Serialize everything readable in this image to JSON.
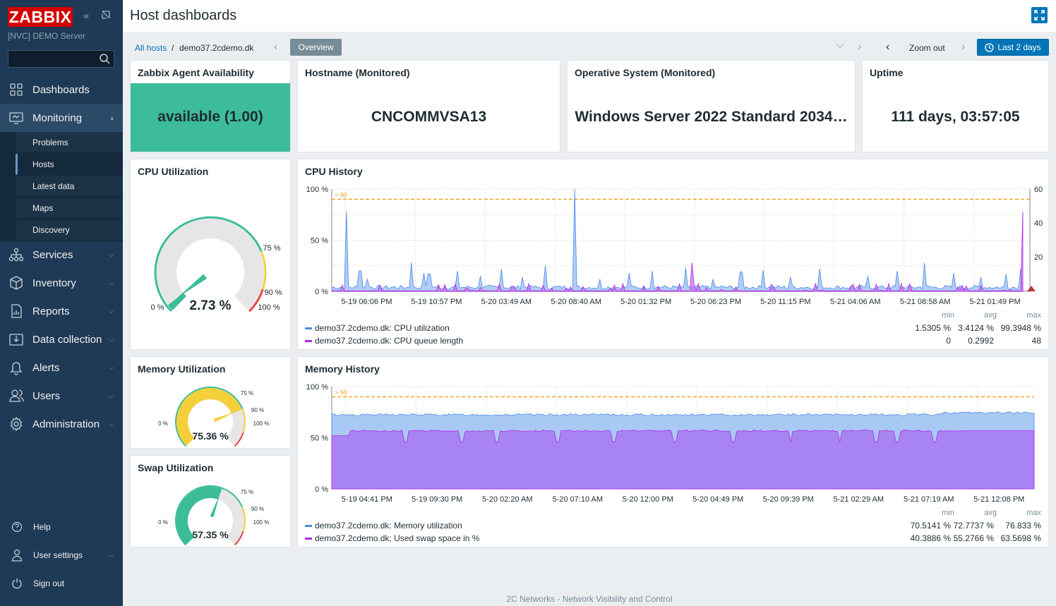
{
  "app": {
    "logo": "ZABBIX",
    "server": "[NVC] DEMO Server"
  },
  "search": {
    "value": "",
    "placeholder": ""
  },
  "menu": [
    {
      "label": "Dashboards",
      "icon": "dashboards-icon"
    },
    {
      "label": "Monitoring",
      "icon": "monitoring-icon"
    },
    {
      "label": "Services",
      "icon": "services-icon"
    },
    {
      "label": "Inventory",
      "icon": "inventory-icon"
    },
    {
      "label": "Reports",
      "icon": "reports-icon"
    },
    {
      "label": "Data collection",
      "icon": "data-collection-icon"
    },
    {
      "label": "Alerts",
      "icon": "alerts-icon"
    },
    {
      "label": "Users",
      "icon": "users-icon"
    },
    {
      "label": "Administration",
      "icon": "administration-icon"
    }
  ],
  "monitoring_sub": [
    "Problems",
    "Hosts",
    "Latest data",
    "Maps",
    "Discovery"
  ],
  "footer_menu": [
    "Help",
    "User settings",
    "Sign out"
  ],
  "header": {
    "title": "Host dashboards"
  },
  "nav": {
    "crumb_all": "All hosts",
    "crumb_sep": "/",
    "crumb_host": "demo37.2cdemo.dk",
    "tab": "Overview",
    "zoom_out": "Zoom out",
    "period": "Last 2 days"
  },
  "widgets": {
    "agent": {
      "title": "Zabbix Agent Availability",
      "value": "available (1.00)",
      "color": "#3dbc9a"
    },
    "hostname": {
      "title": "Hostname (Monitored)",
      "value": "CNCOMMVSA13"
    },
    "os": {
      "title": "Operative System (Monitored)",
      "value": "Windows Server 2022 Standard 2034…"
    },
    "uptime": {
      "title": "Uptime",
      "value": "111 days, 03:57:05"
    },
    "cpu_gauge": {
      "title": "CPU Utilization",
      "value": "2.73 %",
      "level": 2.73,
      "labels": [
        "0 %",
        "75 %",
        "90 %",
        "100 %"
      ]
    },
    "mem_gauge": {
      "title": "Memory Utilization",
      "value": "75.36 %",
      "level": 75.36,
      "labels": [
        "0 %",
        "75 %",
        "90 %",
        "100 %"
      ]
    },
    "swap_gauge": {
      "title": "Swap Utilization",
      "value": "57.35 %",
      "level": 57.35,
      "labels": [
        "0 %",
        "75 %",
        "90 %",
        "100 %"
      ]
    },
    "cpu_history": {
      "title": "CPU History",
      "y_labels": [
        "100 %",
        "50 %",
        "0 %"
      ],
      "y2_labels": [
        "60",
        "40",
        "20"
      ],
      "threshold": "> 90",
      "x_labels": [
        "5-19 06:06 PM",
        "5-19 10:57 PM",
        "5-20 03:49 AM",
        "5-20 08:40 AM",
        "5-20 01:32 PM",
        "5-20 06:23 PM",
        "5-20 11:15 PM",
        "5-21 04:06 AM",
        "5-21 08:58 AM",
        "5-21 01:49 PM"
      ],
      "stat_headers": [
        "min",
        "avg",
        "max"
      ],
      "legend": [
        {
          "name": "demo37.2cdemo.dk: CPU utilization",
          "color": "#4a8be6",
          "min": "1.5305 %",
          "avg": "3.4124 %",
          "max": "99.3948 %"
        },
        {
          "name": "demo37.2cdemo.dk: CPU queue length",
          "color": "#b327e6",
          "min": "0",
          "avg": "0.2992",
          "max": "48"
        }
      ]
    },
    "mem_history": {
      "title": "Memory History",
      "y_labels": [
        "100 %",
        "50 %",
        "0 %"
      ],
      "threshold": "> 90",
      "x_labels": [
        "5-19 04:41 PM",
        "5-19 09:30 PM",
        "5-20 02:20 AM",
        "5-20 07:10 AM",
        "5-20 12:00 PM",
        "5-20 04:49 PM",
        "5-20 09:39 PM",
        "5-21 02:29 AM",
        "5-21 07:19 AM",
        "5-21 12:08 PM"
      ],
      "stat_headers": [
        "min",
        "avg",
        "max"
      ],
      "legend": [
        {
          "name": "demo37.2cdemo.dk: Memory utilization",
          "color": "#4a8be6",
          "min": "70.5141 %",
          "avg": "72.7737 %",
          "max": "76.833 %"
        },
        {
          "name": "demo37.2cdemo.dk: Used swap space in %",
          "color": "#b327e6",
          "min": "40.3886 %",
          "avg": "55.2766 %",
          "max": "63.5698 %"
        }
      ]
    }
  },
  "footer": "2C Networks - Network Visibility and Control"
}
